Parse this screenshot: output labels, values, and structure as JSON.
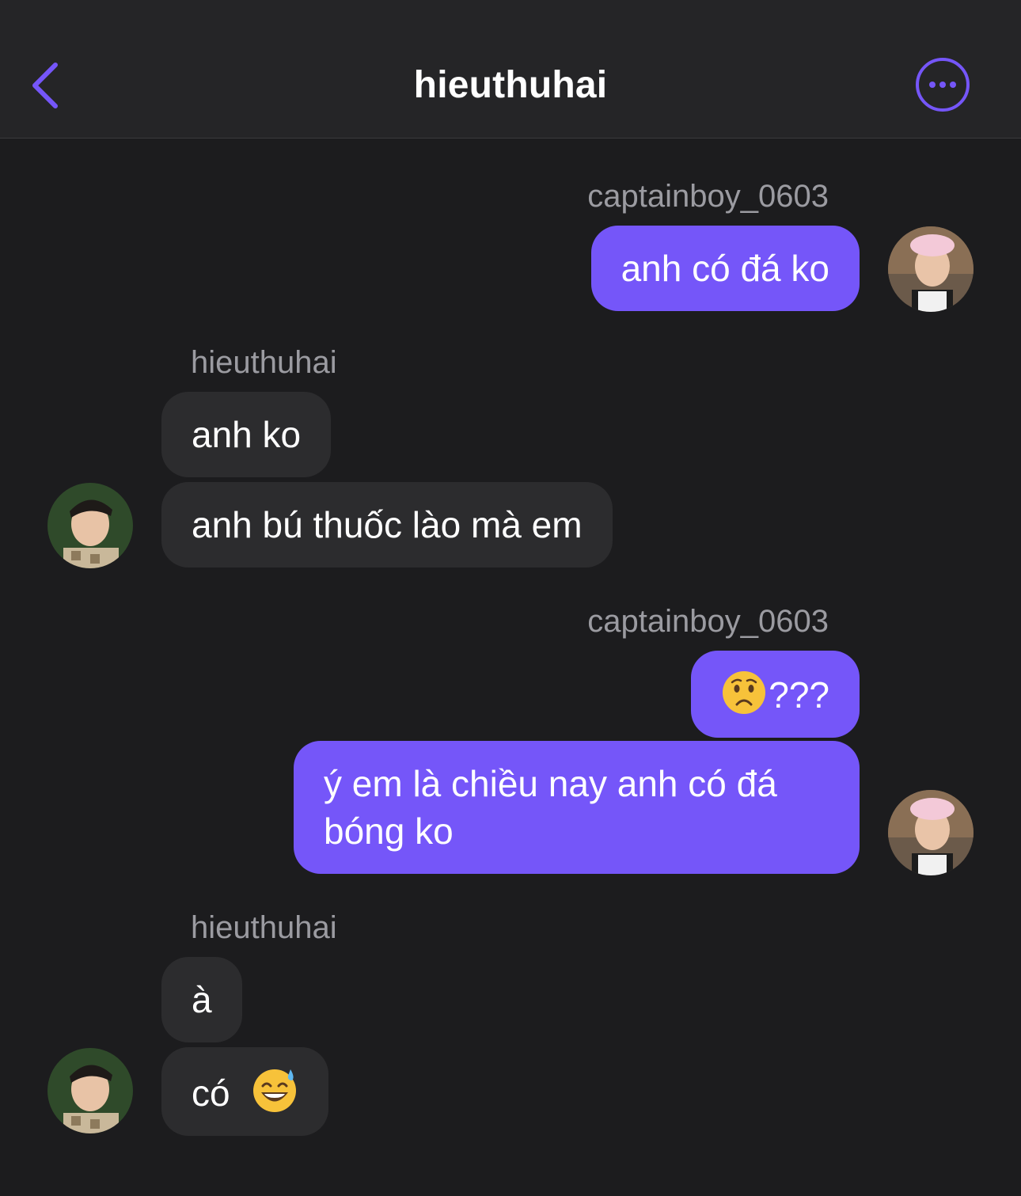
{
  "header": {
    "title": "hieuthuhai"
  },
  "messages": [
    {
      "sender": "captainboy_0603",
      "direction": "outgoing",
      "texts": [
        "anh có đá ko"
      ]
    },
    {
      "sender": "hieuthuhai",
      "direction": "incoming",
      "texts": [
        "anh ko",
        "anh bú thuốc lào mà em"
      ]
    },
    {
      "sender": "captainboy_0603",
      "direction": "outgoing",
      "texts": [
        "???",
        "ý em là chiều nay anh có đá",
        "bóng ko"
      ]
    },
    {
      "sender": "hieuthuhai",
      "direction": "incoming",
      "texts": [
        "à",
        "có"
      ]
    }
  ],
  "icons": {
    "back": "chevron-left-icon",
    "more": "ellipsis-circle-icon",
    "emoji_worried": "worried-face-emoji",
    "emoji_sweat": "grinning-sweat-emoji"
  },
  "colors": {
    "accent": "#7556f9",
    "background": "#1c1c1e",
    "header": "#252527",
    "incoming_bubble": "#2c2c2e",
    "sender_label": "#9b9ba1"
  }
}
